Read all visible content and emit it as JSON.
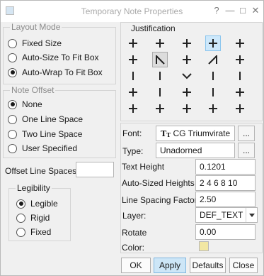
{
  "window": {
    "title": "Temporary Note Properties",
    "title_buttons": [
      "?",
      "—",
      "□",
      "✕"
    ]
  },
  "layout_mode": {
    "legend": "Layout Mode",
    "options": [
      {
        "label": "Fixed Size",
        "checked": false
      },
      {
        "label": "Auto-Size To Fit Box",
        "checked": false
      },
      {
        "label": "Auto-Wrap To Fit Box",
        "checked": true
      }
    ]
  },
  "note_offset": {
    "legend": "Note Offset",
    "options": [
      {
        "label": "None",
        "checked": true
      },
      {
        "label": "One Line Space",
        "checked": false
      },
      {
        "label": "Two Line Space",
        "checked": false
      },
      {
        "label": "User Specified",
        "checked": false
      }
    ]
  },
  "offset_line_spaces": {
    "label": "Offset Line Spaces",
    "value": ""
  },
  "legibility": {
    "legend": "Legibility",
    "options": [
      {
        "label": "Legible",
        "checked": true
      },
      {
        "label": "Rigid",
        "checked": false
      },
      {
        "label": "Fixed",
        "checked": false
      }
    ]
  },
  "justification": {
    "title": "Justification",
    "grid": [
      [
        "plus",
        "plus",
        "plus",
        "plus",
        "plus"
      ],
      [
        "plus",
        "diag-down",
        "plus",
        "diag-up",
        "plus"
      ],
      [
        "bar",
        "bar",
        "chevron",
        "bar",
        "bar"
      ],
      [
        "plus",
        "bar",
        "plus",
        "bar",
        "plus"
      ],
      [
        "plus",
        "plus",
        "plus",
        "plus",
        "plus"
      ]
    ],
    "selected_cell": "0,3",
    "pressed_cell": "1,1"
  },
  "font": {
    "label": "Font:",
    "icon": "truetype-icon",
    "value": "CG Triumvirate",
    "browse_label": "..."
  },
  "type": {
    "label": "Type:",
    "value": "Unadorned",
    "browse_label": "..."
  },
  "text_height": {
    "label": "Text Height",
    "value": "0.1201"
  },
  "auto_sized_heights": {
    "label": "Auto-Sized Heights",
    "value": "2 4 6 8 10"
  },
  "line_spacing_factor": {
    "label": "Line Spacing Factor",
    "value": "2.50"
  },
  "layer": {
    "label": "Layer:",
    "value": "DEF_TEXT"
  },
  "rotate": {
    "label": "Rotate",
    "value": "0.00"
  },
  "color": {
    "label": "Color:",
    "swatch": "#f2e7a3"
  },
  "buttons": {
    "ok": "OK",
    "apply": "Apply",
    "defaults": "Defaults",
    "close": "Close"
  }
}
